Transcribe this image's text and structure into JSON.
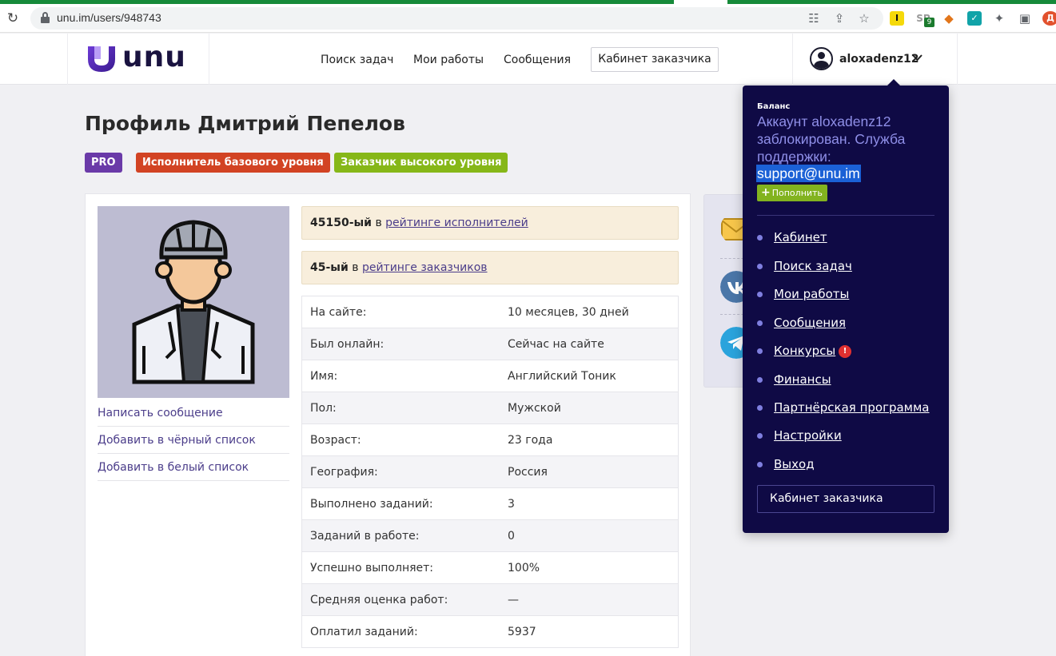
{
  "browser": {
    "url": "unu.im/users/948743",
    "extensions": {
      "sp_badge": "9"
    }
  },
  "header": {
    "logo_text": "unu",
    "nav": [
      "Поиск задач",
      "Мои работы",
      "Сообщения"
    ],
    "cabinet_button": "Кабинет заказчика",
    "username": "aloxadenz12"
  },
  "profile": {
    "title": "Профиль Дмитрий Пепелов",
    "tags": [
      {
        "label": "PRO",
        "color": "#6a3aa8"
      },
      {
        "label": "Исполнитель базового уровня",
        "color": "#d24323"
      },
      {
        "label": "Заказчик высокого уровня",
        "color": "#86b718"
      }
    ],
    "actions": [
      "Написать сообщение",
      "Добавить в чёрный список",
      "Добавить в белый список"
    ],
    "ratings": [
      {
        "rank": "45150-ый",
        "in": "в",
        "link": "рейтинге исполнителей"
      },
      {
        "rank": "45-ый",
        "in": "в",
        "link": "рейтинге заказчиков"
      }
    ],
    "info": [
      {
        "k": "На сайте:",
        "v": "10 месяцев, 30 дней"
      },
      {
        "k": "Был онлайн:",
        "v": "Сейчас на сайте"
      },
      {
        "k": "Имя:",
        "v": "Английский Тоник"
      },
      {
        "k": "Пол:",
        "v": "Мужской"
      },
      {
        "k": "Возраст:",
        "v": "23 года"
      },
      {
        "k": "География:",
        "v": "Россия"
      },
      {
        "k": "Выполнено заданий:",
        "v": "3"
      },
      {
        "k": "Заданий в работе:",
        "v": "0"
      },
      {
        "k": "Успешно выполняет:",
        "v": "100%"
      },
      {
        "k": "Средняя оценка работ:",
        "v": "—"
      },
      {
        "k": "Оплатил заданий:",
        "v": "5937"
      }
    ]
  },
  "dropdown": {
    "balance_label": "Баланс",
    "balance_message": "Аккаунт aloxadenz12 заблокирован. Служба поддержки:",
    "support_email": "support@unu.im",
    "topup_label": "Пополнить",
    "items": [
      "Кабинет",
      "Поиск задач",
      "Мои работы",
      "Сообщения",
      "Конкурсы",
      "Финансы",
      "Партнёрская программа",
      "Настройки",
      "Выход"
    ],
    "alert_mark": "!",
    "cabinet_button": "Кабинет заказчика"
  }
}
